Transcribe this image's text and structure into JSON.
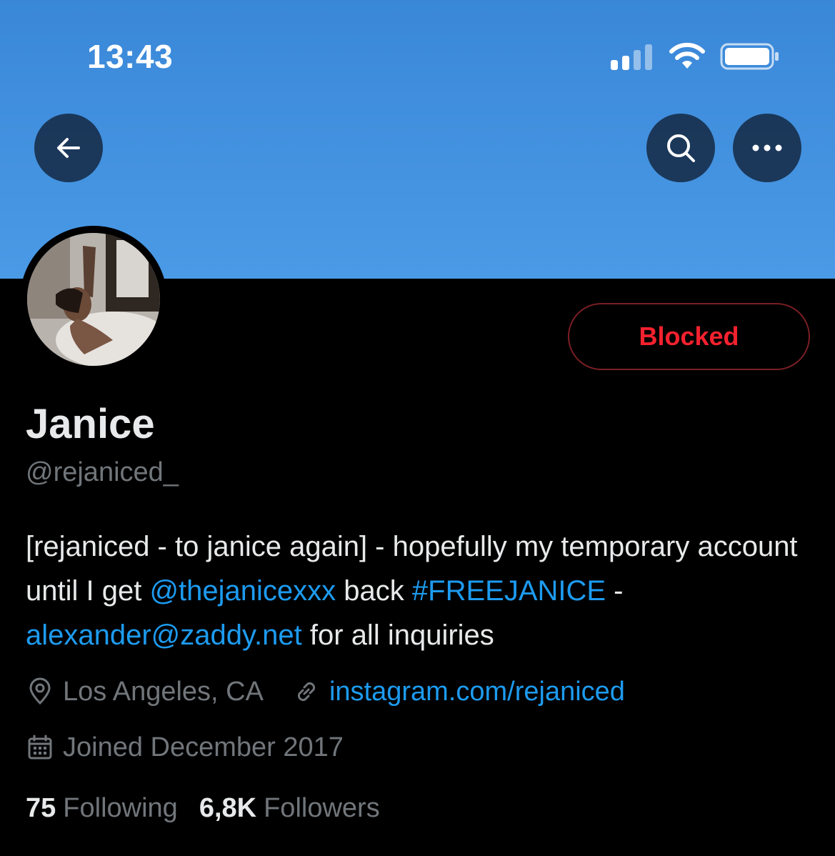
{
  "status_bar": {
    "time": "13:43",
    "signal_icon": "cellular-signal-icon",
    "wifi_icon": "wifi-icon",
    "battery_icon": "battery-icon"
  },
  "header": {
    "back_icon": "arrow-left-icon",
    "search_icon": "search-icon",
    "more_icon": "more-horizontal-icon",
    "banner_color": "#4a9ae6"
  },
  "profile": {
    "avatar_alt": "avatar",
    "blocked_label": "Blocked",
    "display_name": "Janice",
    "handle": "@rejaniced_",
    "bio": {
      "part1": "[rejaniced - to janice again] - hopefully my temporary account until I get ",
      "mention": "@thejanicexxx",
      "part2": " back ",
      "hashtag": "#FREEJANICE",
      "part3": " - ",
      "email": "alexander@zaddy.net",
      "part4": " for all inquiries"
    },
    "location": "Los Angeles, CA",
    "website": "instagram.com/rejaniced",
    "joined": "Joined December 2017",
    "following_count": "75",
    "following_label": "Following",
    "followers_count": "6,8K",
    "followers_label": "Followers"
  },
  "colors": {
    "accent_link": "#1d9bf0",
    "blocked_red": "#f4212e",
    "muted_text": "#71767b"
  }
}
